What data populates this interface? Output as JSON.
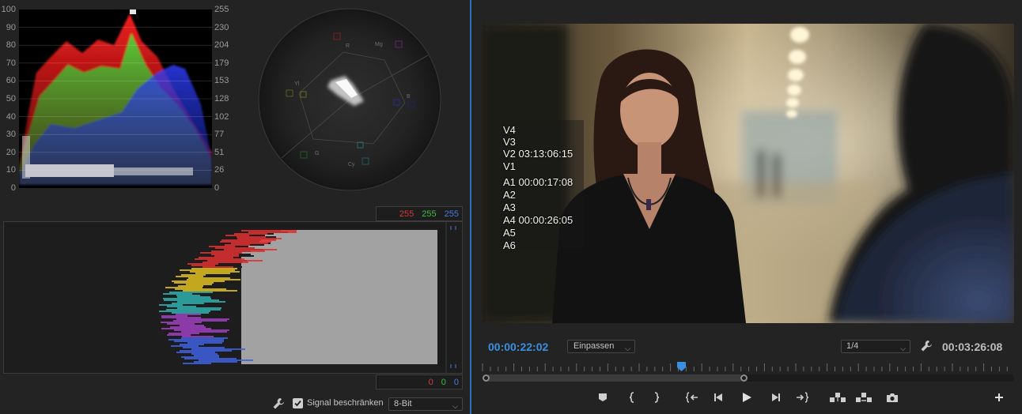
{
  "scopes": {
    "waveform": {
      "left_axis": [
        "100",
        "90",
        "80",
        "70",
        "60",
        "50",
        "40",
        "30",
        "20",
        "10",
        "0"
      ],
      "right_axis": [
        "255",
        "230",
        "204",
        "179",
        "153",
        "128",
        "102",
        "77",
        "51",
        "26",
        "0"
      ]
    },
    "vectorscope": {
      "targets": [
        "R",
        "Mg",
        "B",
        "Cy",
        "G",
        "Yl"
      ]
    },
    "histogram": {
      "top_values": {
        "r": "255",
        "g": "255",
        "b": "255"
      },
      "bottom_values": {
        "r": "0",
        "g": "0",
        "b": "0"
      }
    },
    "footer": {
      "clamp_label": "Signal beschränken",
      "clamp_checked": true,
      "bit_depth": "8-Bit"
    }
  },
  "monitor": {
    "overlay_lines": [
      "V4",
      "V3",
      "V2 03:13:06:15",
      "V1",
      "A1 00:00:17:08",
      "A2",
      "A3",
      "A4 00:00:26:05",
      "A5",
      "A6"
    ],
    "current_timecode": "00:00:22:02",
    "fit_option": "Einpassen",
    "resolution": "1/4",
    "duration": "00:03:26:08",
    "playhead_position": 0.376
  },
  "colors": {
    "accent": "#3b8fe0",
    "panel": "#232323",
    "red": "#d23b3b",
    "green": "#3cbf3c",
    "blue": "#4a7bdc"
  }
}
